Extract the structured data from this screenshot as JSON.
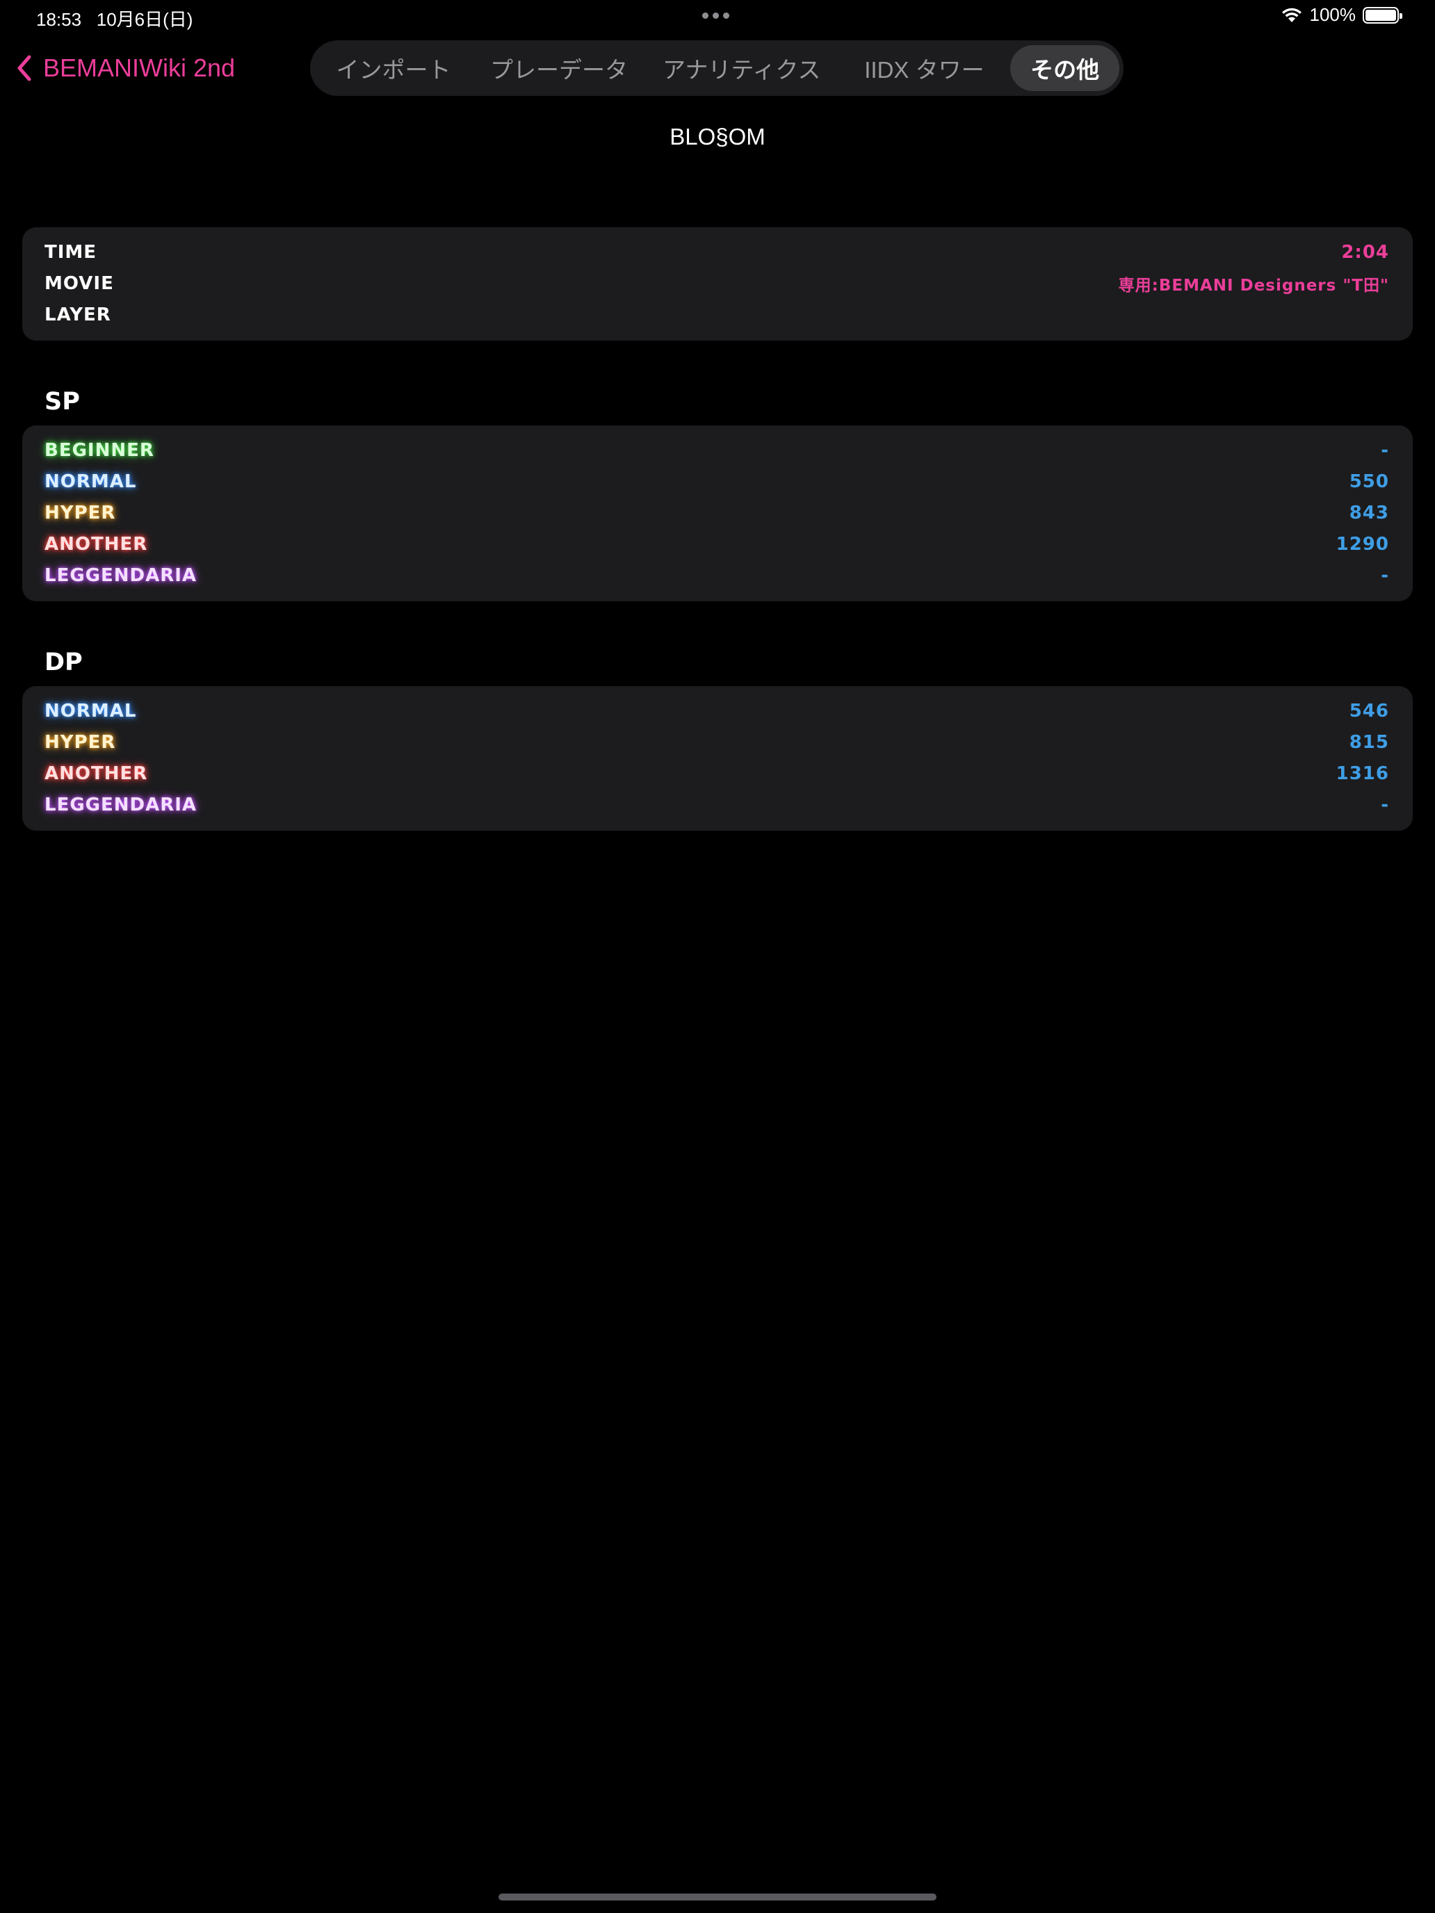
{
  "status_bar": {
    "time": "18:53",
    "date": "10月6日(日)",
    "battery_text": "100%"
  },
  "nav": {
    "back_label": "BEMANIWiki 2nd"
  },
  "tabs": [
    {
      "label": "インポート",
      "active": false
    },
    {
      "label": "プレーデータ",
      "active": false
    },
    {
      "label": "アナリティクス",
      "active": false
    },
    {
      "label": "IIDX タワー",
      "active": false
    },
    {
      "label": "その他",
      "active": true
    }
  ],
  "page": {
    "title": "BLO§OM"
  },
  "info": {
    "time_label": "TIME",
    "time_value": "2:04",
    "movie_label": "MOVIE",
    "movie_value": "専用:BEMANI Designers \"T田\"",
    "layer_label": "LAYER",
    "layer_value": ""
  },
  "sp": {
    "title": "SP",
    "rows": [
      {
        "label": "BEGINNER",
        "value": "-"
      },
      {
        "label": "NORMAL",
        "value": "550"
      },
      {
        "label": "HYPER",
        "value": "843"
      },
      {
        "label": "ANOTHER",
        "value": "1290"
      },
      {
        "label": "LEGGENDARIA",
        "value": "-"
      }
    ]
  },
  "dp": {
    "title": "DP",
    "rows": [
      {
        "label": "NORMAL",
        "value": "546"
      },
      {
        "label": "HYPER",
        "value": "815"
      },
      {
        "label": "ANOTHER",
        "value": "1316"
      },
      {
        "label": "LEGGENDARIA",
        "value": "-"
      }
    ]
  },
  "colors": {
    "accent_pink": "#ec3e9a",
    "value_blue": "#3f9ee6",
    "card_bg": "#1c1c1e",
    "beginner_glow": "#3fd03f",
    "normal_glow": "#3a8fff",
    "hyper_glow": "#f0a020",
    "another_glow": "#ff4040",
    "leggendaria_glow": "#c050ff"
  }
}
